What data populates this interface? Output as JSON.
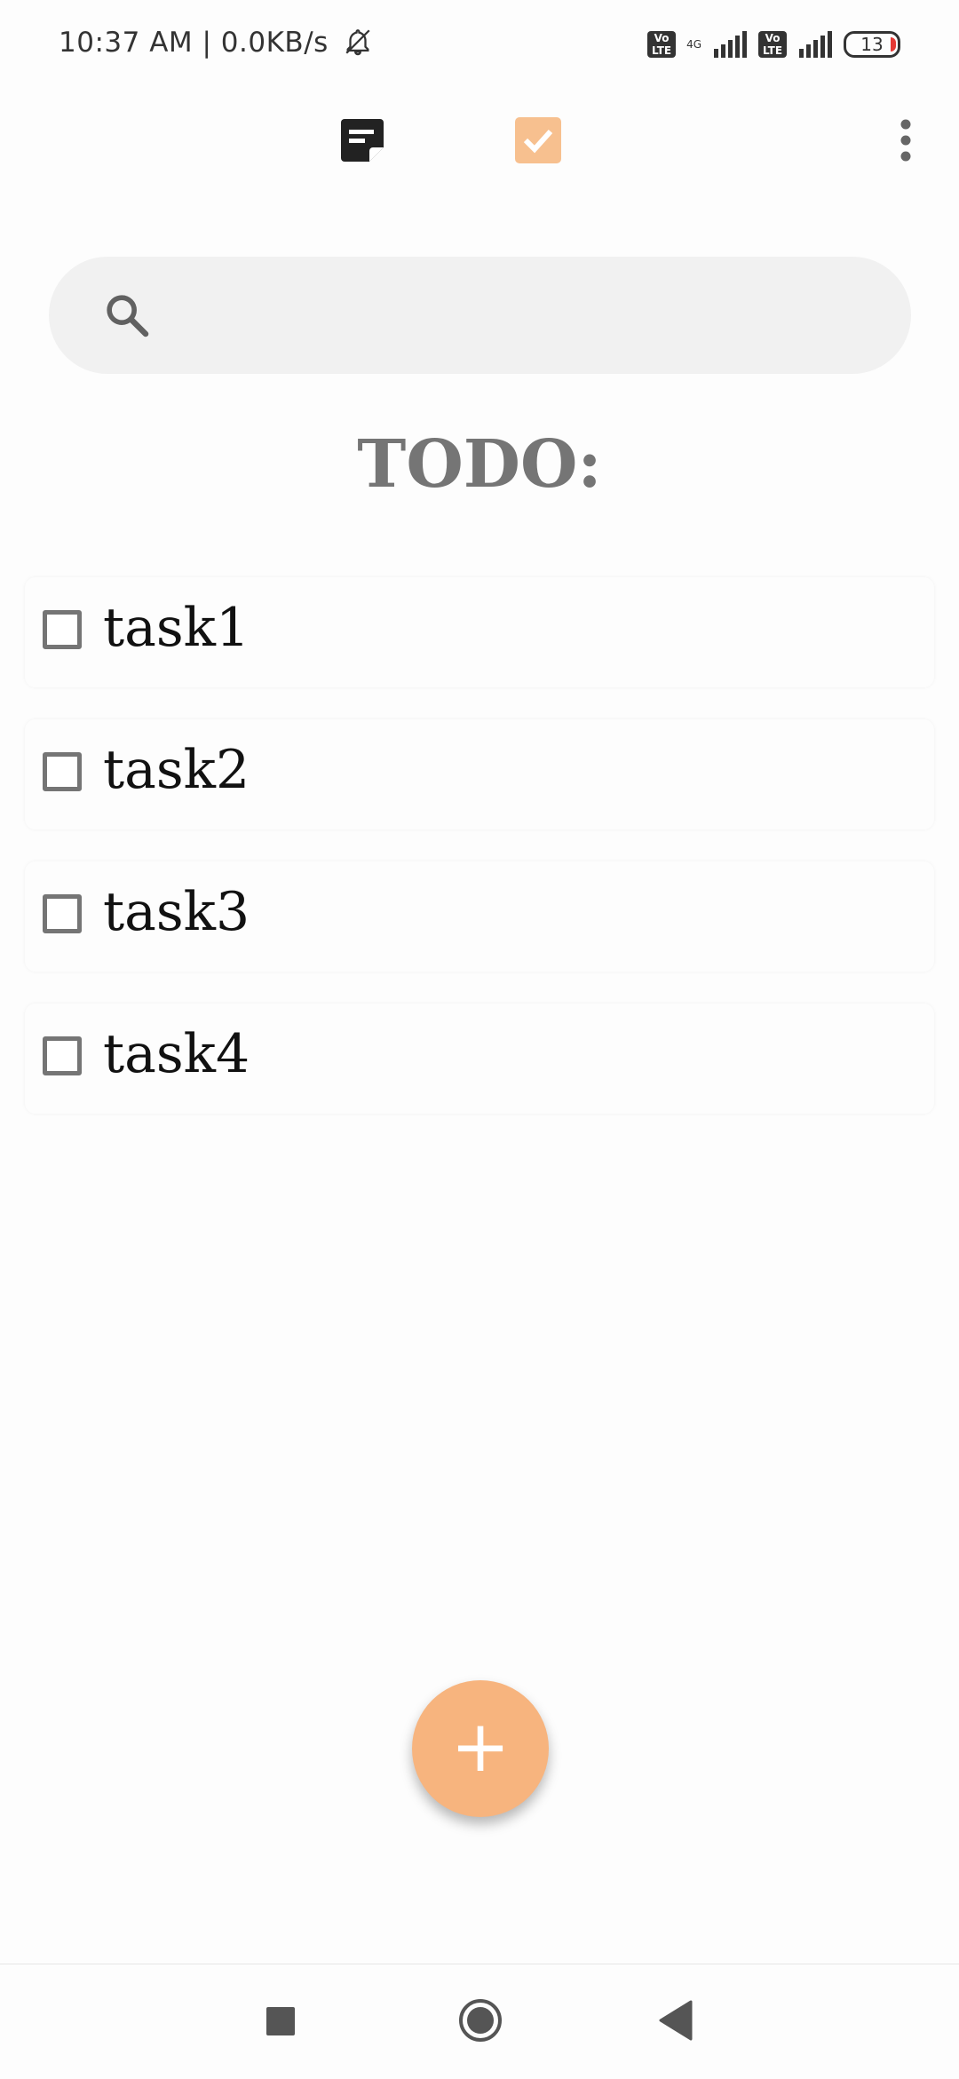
{
  "status_bar": {
    "time_and_speed": "10:37 AM | 0.0KB/s",
    "network": "4G",
    "sim_badge": "Vo LTE",
    "battery": "13"
  },
  "toolbar": {
    "notes_tab_icon": "notes-icon",
    "todo_tab_icon": "checkbox-checked-icon",
    "menu_icon": "more-vert-icon",
    "accent_color": "#f7b47e"
  },
  "search": {
    "placeholder": "",
    "value": ""
  },
  "main": {
    "title": "TODO:",
    "tasks": [
      {
        "label": "task1",
        "checked": false
      },
      {
        "label": "task2",
        "checked": false
      },
      {
        "label": "task3",
        "checked": false
      },
      {
        "label": "task4",
        "checked": false
      }
    ]
  },
  "fab": {
    "label": "+"
  },
  "nav_bar": {
    "recents_icon": "square-icon",
    "home_icon": "circle-icon",
    "back_icon": "triangle-back-icon"
  }
}
